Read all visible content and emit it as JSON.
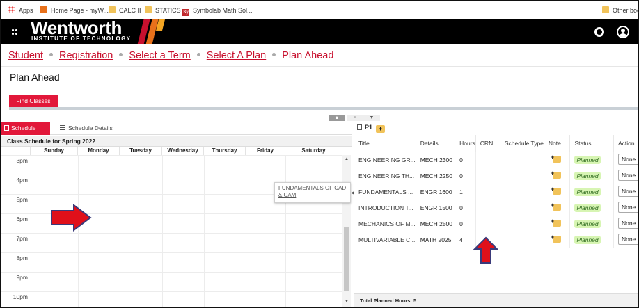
{
  "bookmarks": {
    "items": [
      "Apps",
      "Home Page - myW...",
      "CALC II",
      "STATICS",
      "Symbolab Math Sol..."
    ],
    "other": "Other boo"
  },
  "header": {
    "logo": "Wentworth",
    "logo_sub": "INSTITUTE OF TECHNOLOGY",
    "icons": [
      "menu-icon",
      "gear-icon",
      "user-icon"
    ],
    "stripe_colors": [
      "#c8102e",
      "#e8711b",
      "#f5a623"
    ]
  },
  "breadcrumb": {
    "items": [
      "Student",
      "Registration",
      "Select a Term",
      "Select A Plan"
    ],
    "current": "Plan Ahead"
  },
  "page": {
    "title": "Plan Ahead",
    "find_classes": "Find Classes"
  },
  "schedule": {
    "tabs": {
      "schedule": "Schedule",
      "details": "Schedule Details"
    },
    "title": "Class Schedule for Spring 2022",
    "days": [
      "Sunday",
      "Monday",
      "Tuesday",
      "Wednesday",
      "Thursday",
      "Friday",
      "Saturday"
    ],
    "hours": [
      "3pm",
      "4pm",
      "5pm",
      "6pm",
      "7pm",
      "8pm",
      "9pm",
      "10pm"
    ],
    "popup": "FUNDAMENTALS OF CAD & CAM"
  },
  "plan": {
    "name": "P1",
    "columns": [
      "Title",
      "Details",
      "Hours",
      "CRN",
      "Schedule Type",
      "Note",
      "Status",
      "Action"
    ],
    "rows": [
      {
        "title": "ENGINEERING GR...",
        "details": "MECH 2300",
        "hours": "0",
        "status": "Planned",
        "action": "None"
      },
      {
        "title": "ENGINEERING TH...",
        "details": "MECH 2250",
        "hours": "0",
        "status": "Planned",
        "action": "None"
      },
      {
        "title": "FUNDAMENTALS ...",
        "details": "ENGR 1600",
        "hours": "1",
        "status": "Planned",
        "action": "None"
      },
      {
        "title": "INTRODUCTION T...",
        "details": "ENGR 1500",
        "hours": "0",
        "status": "Planned",
        "action": "None"
      },
      {
        "title": "MECHANICS OF M...",
        "details": "MECH 2500",
        "hours": "0",
        "status": "Planned",
        "action": "None"
      },
      {
        "title": "MULTIVARIABLE C...",
        "details": "MATH 2025",
        "hours": "4",
        "status": "Planned",
        "action": "None"
      }
    ],
    "footer": "Total Planned Hours: 5"
  },
  "annotations": {
    "arrow_color": "#e0101a"
  }
}
